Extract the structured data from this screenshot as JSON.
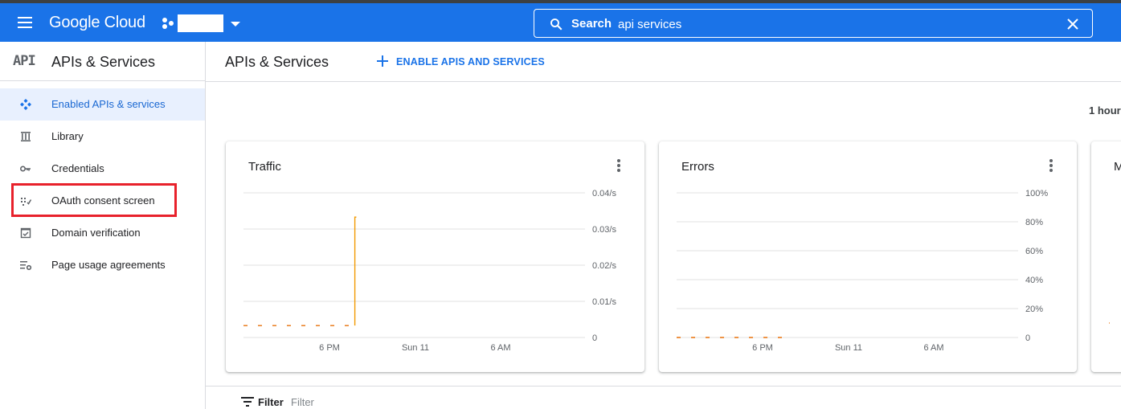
{
  "header": {
    "brand": "Google Cloud",
    "search_label": "Search",
    "search_value": "api services"
  },
  "sidebar": {
    "badge": "API",
    "title": "APIs & Services",
    "items": [
      {
        "label": "Enabled APIs & services",
        "icon": "enabled-apis-icon",
        "active": true
      },
      {
        "label": "Library",
        "icon": "library-icon"
      },
      {
        "label": "Credentials",
        "icon": "key-icon"
      },
      {
        "label": "OAuth consent screen",
        "icon": "oauth-consent-icon",
        "highlighted": true
      },
      {
        "label": "Domain verification",
        "icon": "domain-verification-icon"
      },
      {
        "label": "Page usage agreements",
        "icon": "page-usage-icon"
      }
    ]
  },
  "main": {
    "title": "APIs & Services",
    "enable_button": "ENABLE APIS AND SERVICES",
    "time_range": "1 hour",
    "filter_label": "Filter",
    "filter_placeholder": "Filter"
  },
  "colors": {
    "accent": "#1a73e8",
    "active_bg": "#e8f0fe",
    "highlight": "#e8212b",
    "series": "#f29900",
    "dashed": "#e8710a"
  },
  "chart_data": [
    {
      "type": "line",
      "title": "Traffic",
      "xticks": [
        "6 PM",
        "Sun 11",
        "6 AM"
      ],
      "yticks": [
        "0",
        "0.01/s",
        "0.02/s",
        "0.03/s",
        "0.04/s"
      ],
      "ylim": [
        0,
        0.04
      ],
      "grid": true,
      "series": [
        {
          "style": "dashed",
          "x": [
            0,
            0.75
          ],
          "y": [
            0.0033,
            0.0033
          ]
        },
        {
          "style": "solid",
          "x": [
            0.75,
            0.75,
            0.76
          ],
          "y": [
            0.0033,
            0.0333,
            0.0333
          ]
        }
      ],
      "xlim": [
        0,
        2.3
      ]
    },
    {
      "type": "line",
      "title": "Errors",
      "xticks": [
        "6 PM",
        "Sun 11",
        "6 AM"
      ],
      "yticks": [
        "0",
        "20%",
        "40%",
        "60%",
        "80%",
        "100%"
      ],
      "ylim": [
        0,
        100
      ],
      "grid": true,
      "series": [
        {
          "style": "dashed",
          "x": [
            0,
            0.75
          ],
          "y": [
            0,
            0
          ]
        }
      ],
      "xlim": [
        0,
        2.3
      ]
    },
    {
      "type": "line",
      "title": "M",
      "series": [
        {
          "style": "dashed",
          "x": [
            0,
            0.02
          ],
          "y": [
            0.1,
            0.1
          ]
        }
      ]
    }
  ]
}
